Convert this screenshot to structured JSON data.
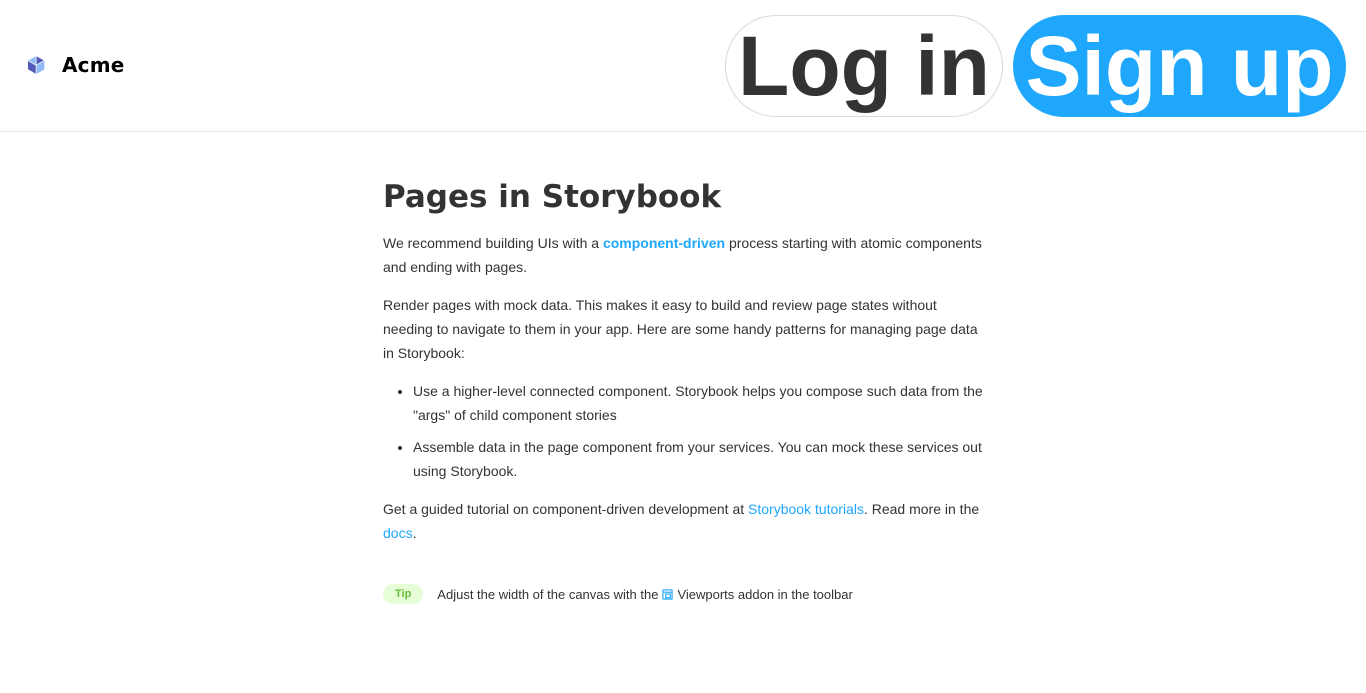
{
  "header": {
    "brand_name": "Acme",
    "login_label": "Log in",
    "signup_label": "Sign up"
  },
  "main": {
    "title": "Pages in Storybook",
    "para1_before": "We recommend building UIs with a ",
    "para1_link": "component-driven",
    "para1_after": " process starting with atomic components and ending with pages.",
    "para2": "Render pages with mock data. This makes it easy to build and review page states without needing to navigate to them in your app. Here are some handy patterns for managing page data in Storybook:",
    "list_items": [
      "Use a higher-level connected component. Storybook helps you compose such data from the \"args\" of child component stories",
      "Assemble data in the page component from your services. You can mock these services out using Storybook."
    ],
    "para3_before": "Get a guided tutorial on component-driven development at ",
    "para3_link1": "Storybook tutorials",
    "para3_middle": ". Read more in the ",
    "para3_link2": "docs",
    "para3_after": "."
  },
  "tip": {
    "badge": "Tip",
    "text_before": "Adjust the width of the canvas with the ",
    "text_after": "Viewports addon in the toolbar",
    "icon": "viewport-icon"
  },
  "colors": {
    "accent": "#1ea7fd",
    "tip_bg": "#e7fdd8",
    "tip_text": "#66bf3c",
    "text": "#333333"
  }
}
